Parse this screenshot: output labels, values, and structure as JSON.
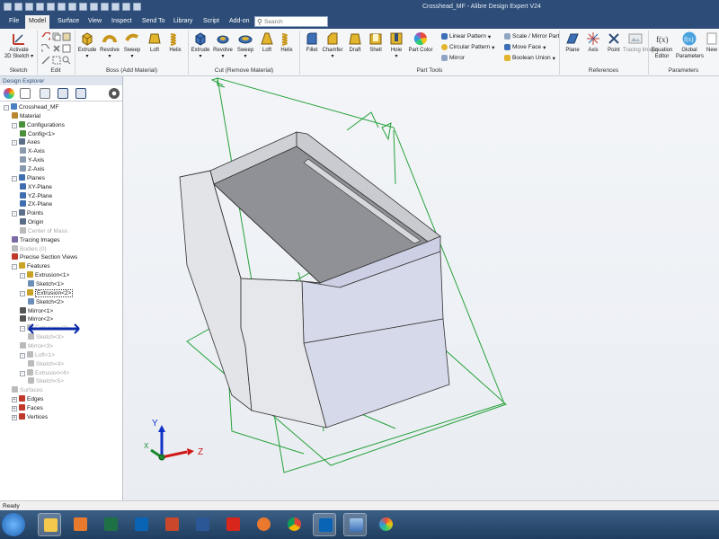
{
  "window": {
    "title": "Crosshead_MF - Alibre Design Expert V24"
  },
  "menu": {
    "items": [
      "File",
      "Model",
      "Surface",
      "View",
      "Inspect",
      "Send To",
      "Library",
      "Script",
      "Add-on"
    ],
    "active": "Model"
  },
  "search": {
    "placeholder": "Search"
  },
  "ribbon": {
    "groups": {
      "sketch": "Sketch",
      "edit": "Edit",
      "boss": "Boss (Add Material)",
      "cut": "Cut (Remove Material)",
      "part_tools": "Part Tools",
      "references": "References",
      "parameters": "Parameters"
    },
    "sketch_btn": [
      "Activate",
      "2D Sketch ▾"
    ],
    "boss_buttons": [
      "Extrude",
      "Revolve",
      "Sweep",
      "Loft",
      "Helix"
    ],
    "cut_buttons": [
      "Extrude",
      "Revolve",
      "Sweep",
      "Loft",
      "Helix"
    ],
    "tool_buttons": [
      "Fillet",
      "Chamfer",
      "Draft",
      "Shell",
      "Hole",
      "Part Color"
    ],
    "pattern_rows": [
      "Linear Pattern",
      "Circular Pattern",
      "Mirror"
    ],
    "transform_rows": [
      "Scale / Mirror Part",
      "Move Face",
      "Boolean Union"
    ],
    "ref_buttons": [
      "Plane",
      "Axis",
      "Point",
      "Tracing Image"
    ],
    "param_buttons": [
      [
        "Equation",
        "Editor"
      ],
      [
        "Global",
        "Parameters"
      ],
      [
        "New"
      ]
    ]
  },
  "tree": {
    "header": "Design Explorer",
    "rows": [
      {
        "text": "Crosshead_MF",
        "indent": 0,
        "exp": "-",
        "color": "#4a7fc1"
      },
      {
        "text": "Material",
        "indent": 1,
        "exp": "",
        "color": "#b8862e"
      },
      {
        "text": "Configurations",
        "indent": 1,
        "exp": "-",
        "color": "#4a8f3a"
      },
      {
        "text": "Config<1>",
        "indent": 2,
        "exp": "",
        "color": "#4a8f3a"
      },
      {
        "text": "Axes",
        "indent": 1,
        "exp": "-",
        "color": "#5a6e88"
      },
      {
        "text": "X-Axis",
        "indent": 2,
        "exp": "",
        "color": "#8a9bb0"
      },
      {
        "text": "Y-Axis",
        "indent": 2,
        "exp": "",
        "color": "#8a9bb0"
      },
      {
        "text": "Z-Axis",
        "indent": 2,
        "exp": "",
        "color": "#8a9bb0"
      },
      {
        "text": "Planes",
        "indent": 1,
        "exp": "-",
        "color": "#3f6fb0"
      },
      {
        "text": "XY-Plane",
        "indent": 2,
        "exp": "",
        "color": "#3f6fb0"
      },
      {
        "text": "YZ-Plane",
        "indent": 2,
        "exp": "",
        "color": "#3f6fb0"
      },
      {
        "text": "ZX-Plane",
        "indent": 2,
        "exp": "",
        "color": "#3f6fb0"
      },
      {
        "text": "Points",
        "indent": 1,
        "exp": "-",
        "color": "#5a6e88"
      },
      {
        "text": "Origin",
        "indent": 2,
        "exp": "",
        "color": "#5a6e88"
      },
      {
        "text": "Center of Mass",
        "indent": 2,
        "exp": "",
        "color": "#bbbbbb",
        "dim": true
      },
      {
        "text": "Tracing Images",
        "indent": 1,
        "exp": "",
        "color": "#7c6aa8"
      },
      {
        "text": "Bodies (0)",
        "indent": 1,
        "exp": "",
        "color": "#bbbbbb",
        "dim": true
      },
      {
        "text": "Precise Section Views",
        "indent": 1,
        "exp": "",
        "color": "#c0392b"
      },
      {
        "text": "Features",
        "indent": 1,
        "exp": "-",
        "color": "#c9a227"
      },
      {
        "text": "Extrusion<1>",
        "indent": 2,
        "exp": "-",
        "color": "#c9a227"
      },
      {
        "text": "Sketch<1>",
        "indent": 3,
        "exp": "",
        "color": "#6c8fb8"
      },
      {
        "text": "Extrusion<2>",
        "indent": 2,
        "exp": "-",
        "color": "#c9a227",
        "sel": true
      },
      {
        "text": "Sketch<2>",
        "indent": 3,
        "exp": "",
        "color": "#6c8fb8"
      },
      {
        "text": "Mirror<1>",
        "indent": 2,
        "exp": "",
        "color": "#555555"
      },
      {
        "text": "Mirror<2>",
        "indent": 2,
        "exp": "",
        "color": "#555555"
      },
      {
        "text": "Extrusion<3>",
        "indent": 2,
        "exp": "-",
        "color": "#bbbbbb",
        "dim": true
      },
      {
        "text": "Sketch<3>",
        "indent": 3,
        "exp": "",
        "color": "#bbbbbb",
        "dim": true
      },
      {
        "text": "Mirror<3>",
        "indent": 2,
        "exp": "",
        "color": "#bbbbbb",
        "dim": true
      },
      {
        "text": "Loft<1>",
        "indent": 2,
        "exp": "-",
        "color": "#bbbbbb",
        "dim": true
      },
      {
        "text": "Sketch<4>",
        "indent": 3,
        "exp": "",
        "color": "#bbbbbb",
        "dim": true
      },
      {
        "text": "Extrusion<4>",
        "indent": 2,
        "exp": "-",
        "color": "#bbbbbb",
        "dim": true
      },
      {
        "text": "Sketch<5>",
        "indent": 3,
        "exp": "",
        "color": "#bbbbbb",
        "dim": true
      },
      {
        "text": "Surfaces",
        "indent": 1,
        "exp": "",
        "color": "#bbbbbb",
        "dim": true
      },
      {
        "text": "Edges",
        "indent": 1,
        "exp": "+",
        "color": "#c0392b"
      },
      {
        "text": "Faces",
        "indent": 1,
        "exp": "+",
        "color": "#c0392b"
      },
      {
        "text": "Vertices",
        "indent": 1,
        "exp": "+",
        "color": "#c0392b"
      }
    ]
  },
  "triad": {
    "x": "X",
    "y": "Y",
    "z": "Z"
  },
  "status": {
    "text": "Ready"
  },
  "colors": {
    "title_bg": "#2d4d78",
    "model_face": "#d6d9ea",
    "model_top": "#8f9196",
    "sketch_green": "#27a13a",
    "taskbar": "#2b4c70"
  },
  "taskbar": {
    "apps": [
      "start-button",
      "file-explorer",
      "media-player",
      "excel",
      "outlook",
      "powerpoint",
      "word",
      "acrobat",
      "firefox",
      "chrome",
      "outlook-2",
      "alibre-design",
      "paint"
    ]
  }
}
